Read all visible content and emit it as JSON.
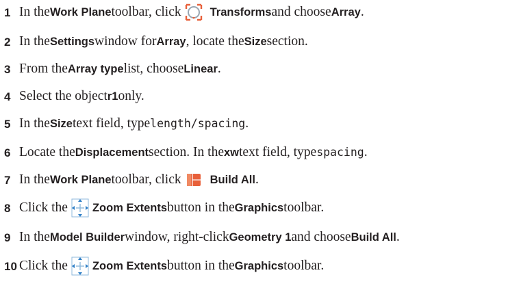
{
  "steps": [
    {
      "num": "1",
      "t1": "In the ",
      "work_plane": "Work Plane",
      "t2": " toolbar, click ",
      "icon": "transforms-icon",
      "transforms": "Transforms",
      "t3": " and choose ",
      "array": "Array",
      "t4": "."
    },
    {
      "num": "2",
      "t1": "In the ",
      "settings": "Settings",
      "t2": " window for ",
      "array": "Array",
      "t3": ", locate the ",
      "size": "Size",
      "t4": " section."
    },
    {
      "num": "3",
      "t1": "From the ",
      "array_type": "Array type",
      "t2": " list, choose ",
      "linear": "Linear",
      "t3": "."
    },
    {
      "num": "4",
      "t1": "Select the object ",
      "r1": "r1",
      "t2": " only."
    },
    {
      "num": "5",
      "t1": "In the ",
      "size": "Size",
      "t2": " text field, type ",
      "code": "length/spacing",
      "t3": "."
    },
    {
      "num": "6",
      "t1": "Locate the ",
      "displacement": "Displacement",
      "t2": " section. In the ",
      "xw": "xw",
      "t3": " text field, type ",
      "code": "spacing",
      "t4": "."
    },
    {
      "num": "7",
      "t1": "In the ",
      "work_plane": "Work Plane",
      "t2": " toolbar, click ",
      "icon": "build-all-icon",
      "build_all": "Build All",
      "t3": "."
    },
    {
      "num": "8",
      "t1": "Click the ",
      "icon": "zoom-extents-icon",
      "zoom_extents": "Zoom Extents",
      "t2": " button in the ",
      "graphics": "Graphics",
      "t3": " toolbar."
    },
    {
      "num": "9",
      "t1": "In the ",
      "model_builder": "Model Builder",
      "t2": " window, right-click ",
      "geometry": "Geometry 1",
      "t3": " and choose ",
      "build_all": "Build All",
      "t4": "."
    },
    {
      "num": "10",
      "t1": "Click the ",
      "icon": "zoom-extents-icon",
      "zoom_extents": "Zoom Extents",
      "t2": " button in the ",
      "graphics": "Graphics",
      "t3": " toolbar."
    }
  ],
  "colors": {
    "text": "#231f20",
    "transforms_arrows": "#e8603a",
    "transforms_ring": "#9aa6b2",
    "build_all": "#e8603a",
    "zoom_frame": "#8fb9dc",
    "zoom_arrows": "#2f7fc6"
  }
}
